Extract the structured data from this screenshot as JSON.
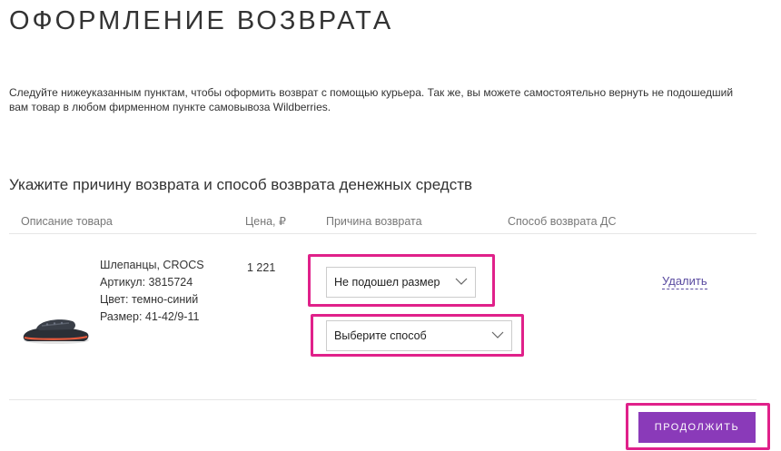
{
  "page": {
    "title": "ОФОРМЛЕНИЕ ВОЗВРАТА",
    "intro": "Следуйте нижеуказанным пунктам, чтобы оформить возврат с помощью курьера. Так же, вы можете самостоятельно вернуть не подошедший вам товар в любом фирменном пункте самовывоза Wildberries."
  },
  "section": {
    "title": "Укажите причину возврата и способ возврата денежных средств"
  },
  "table": {
    "headers": {
      "description": "Описание товара",
      "price": "Цена, ₽",
      "reason": "Причина возврата",
      "method": "Способ возврата ДС"
    },
    "rows": [
      {
        "name": "Шлепанцы, CROCS",
        "article": "Артикул: 3815724",
        "color": "Цвет: темно-синий",
        "size": "Размер: 41-42/9-11",
        "price": "1 221",
        "reason_selected": "Не подошел размер",
        "method_selected": "Выберите способ",
        "delete_label": "Удалить"
      }
    ]
  },
  "actions": {
    "continue_label": "продолжить"
  },
  "icons": {
    "select_arrow": "chevron-down-icon",
    "product_image": "slipper-image"
  },
  "colors": {
    "accent": "#8a3ab9",
    "highlight": "#e0218a",
    "link": "#5a4ba0"
  }
}
